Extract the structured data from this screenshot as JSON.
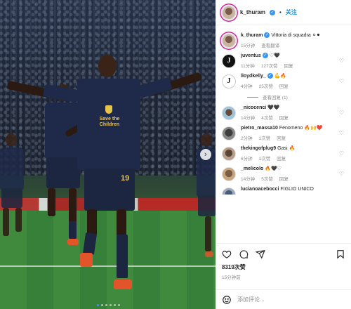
{
  "header": {
    "username": "k_thuram",
    "verified_glyph": "✓",
    "separator": "•",
    "follow_label": "关注",
    "more_icon": "more-horizontal-icon"
  },
  "media": {
    "jersey_text": "Save the Children",
    "player_number": "19",
    "carousel_count": 6,
    "carousel_active": 0,
    "next_glyph": "›"
  },
  "caption": {
    "username": "k_thuram",
    "text": "Vittoria di squadra ⚪⚫",
    "time": "15分钟",
    "translate_label": "查看翻译"
  },
  "comments": [
    {
      "username": "juventus",
      "verified": true,
      "text": "♡🖤",
      "time": "11分钟",
      "likes": "127次赞",
      "reply": "回复",
      "avatar": "juventus-logo"
    },
    {
      "username": "lloydkelly_",
      "verified": true,
      "text": "💪🔥",
      "time": "4分钟",
      "likes": "25次赞",
      "reply": "回复",
      "avatar": "juventus-logo-white",
      "view_replies": "查看回复 (1)"
    },
    {
      "username": "_nicocenci",
      "verified": false,
      "text": "🖤🖤",
      "time": "14分钟",
      "likes": "4次赞",
      "reply": "回复",
      "avatar": "profile-photo"
    },
    {
      "username": "pietro_massa10",
      "verified": false,
      "text": "Fenomeno 🔥🙌❤️",
      "time": "2分钟",
      "likes": "1次赞",
      "reply": "回复",
      "avatar": "profile-photo"
    },
    {
      "username": "thekingofplug9",
      "verified": false,
      "text": "Gasi 🔥",
      "time": "6分钟",
      "likes": "1次赞",
      "reply": "回复",
      "avatar": "profile-photo"
    },
    {
      "username": "_melicolo",
      "verified": false,
      "text": "🔥🖤♡",
      "time": "14分钟",
      "likes": "5次赞",
      "reply": "回复",
      "avatar": "profile-photo"
    },
    {
      "username": "lucianoacebocci",
      "verified": false,
      "text": "FIGLIO UNICO",
      "time": "",
      "likes": "",
      "reply": "",
      "avatar": "profile-photo"
    }
  ],
  "actions": {
    "like_icon": "heart-icon",
    "comment_icon": "comment-icon",
    "share_icon": "send-icon",
    "save_icon": "bookmark-icon",
    "likes_count": "8319次赞",
    "posted_time": "15分钟前"
  },
  "composer": {
    "placeholder": "添加评论...",
    "emoji_icon": "smiley-icon"
  },
  "colors": {
    "link_blue": "#0095f6",
    "verified_blue": "#3897f0",
    "muted_text": "#8e8e8e",
    "divider": "#efefef"
  }
}
